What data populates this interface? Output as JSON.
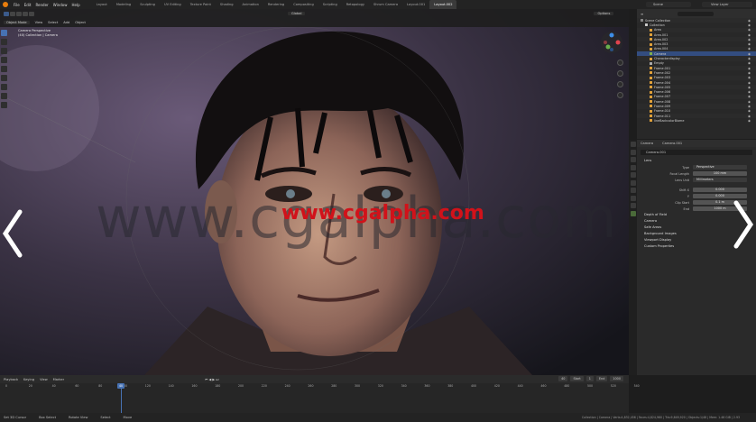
{
  "menu": [
    "File",
    "Edit",
    "Render",
    "Window",
    "Help"
  ],
  "workspaces": [
    "Layout",
    "Modeling",
    "Sculpting",
    "UV Editing",
    "Texture Paint",
    "Shading",
    "Animation",
    "Rendering",
    "Compositing",
    "Scripting",
    "Retopology",
    "Shrum Camera",
    "Layout.001",
    "Layout.002"
  ],
  "active_workspace": "Layout.002",
  "scene": "Scene",
  "view_layer": "View Layer",
  "viewport": {
    "mode": "Object Mode",
    "menus": [
      "View",
      "Select",
      "Add",
      "Object"
    ],
    "transform": "Global",
    "options": "Options",
    "cam_title": "Camera Perspective",
    "cam_sub": "(40) Collection | Camera"
  },
  "watermark_grey": "www.cgalpha.com",
  "watermark_red": "www.cgalpha.com",
  "outliner": {
    "title": "Scene Collection",
    "rows": [
      {
        "label": "Scene Collection",
        "indent": 0,
        "color": "#888"
      },
      {
        "label": "Collection",
        "indent": 1,
        "color": "#ccc"
      },
      {
        "label": "Area",
        "indent": 2,
        "color": "#e2a23a"
      },
      {
        "label": "Area.001",
        "indent": 2,
        "color": "#e2a23a"
      },
      {
        "label": "Area.002",
        "indent": 2,
        "color": "#e2a23a"
      },
      {
        "label": "Area.003",
        "indent": 2,
        "color": "#e2a23a"
      },
      {
        "label": "Area.004",
        "indent": 2,
        "color": "#e2a23a"
      },
      {
        "label": "Camera",
        "indent": 2,
        "color": "#7fb04c",
        "selected": true
      },
      {
        "label": "Characterdisplay",
        "indent": 2,
        "color": "#e2a23a"
      },
      {
        "label": "Empty",
        "indent": 2,
        "color": "#aaa"
      },
      {
        "label": "Frame.001",
        "indent": 2,
        "color": "#e2a23a"
      },
      {
        "label": "Frame.002",
        "indent": 2,
        "color": "#e2a23a"
      },
      {
        "label": "Frame.003",
        "indent": 2,
        "color": "#e2a23a"
      },
      {
        "label": "Frame.004",
        "indent": 2,
        "color": "#e2a23a"
      },
      {
        "label": "Frame.005",
        "indent": 2,
        "color": "#e2a23a"
      },
      {
        "label": "Frame.006",
        "indent": 2,
        "color": "#e2a23a"
      },
      {
        "label": "Frame.007",
        "indent": 2,
        "color": "#e2a23a"
      },
      {
        "label": "Frame.008",
        "indent": 2,
        "color": "#e2a23a"
      },
      {
        "label": "Frame.009",
        "indent": 2,
        "color": "#e2a23a"
      },
      {
        "label": "Frame.010",
        "indent": 2,
        "color": "#e2a23a"
      },
      {
        "label": "Frame.011",
        "indent": 2,
        "color": "#e2a23a"
      },
      {
        "label": "lineBackcolorBiome",
        "indent": 2,
        "color": "#e2a23a"
      }
    ]
  },
  "properties": {
    "tabs": [
      "Camera",
      "Camera.001"
    ],
    "name": "Camera.001",
    "section_lens": "Lens",
    "rows": [
      {
        "label": "Type",
        "value": "Perspective"
      },
      {
        "label": "Focal Length",
        "value": "100 mm"
      },
      {
        "label": "Lens Unit",
        "value": "Millimeters"
      },
      {
        "label": "Shift X",
        "value": "0.000"
      },
      {
        "label": "Y",
        "value": "0.000"
      },
      {
        "label": "Clip Start",
        "value": "0.1 m"
      },
      {
        "label": "End",
        "value": "1000 m"
      }
    ],
    "sections": [
      "Depth of Field",
      "Camera",
      "Safe Areas",
      "Background Images",
      "Viewport Display",
      "Custom Properties"
    ]
  },
  "timeline": {
    "menus": [
      "Playback",
      "Keying",
      "View",
      "Marker"
    ],
    "current_frame": "40",
    "start_label": "Start",
    "start": "1",
    "end_label": "End",
    "end": "1000",
    "ticks": [
      "0",
      "20",
      "40",
      "60",
      "80",
      "100",
      "120",
      "140",
      "160",
      "180",
      "200",
      "220",
      "240",
      "260",
      "280",
      "300",
      "320",
      "340",
      "360",
      "380",
      "400",
      "420",
      "440",
      "460",
      "480",
      "500",
      "520",
      "540"
    ]
  },
  "status": {
    "left": [
      "Set 3D Cursor",
      "Box Select",
      "Rotate View",
      "Select",
      "Move"
    ],
    "right": "Collection | Camera | Verts:4,832,456 | Faces:4,824,960 | Tris:9,649,920 | Objects:1/48 | Mem: 1.46 GiB | 2.93"
  },
  "colors": {
    "accent": "#4772b3",
    "brand": "#e87d0d",
    "watermark": "#d1121a"
  }
}
